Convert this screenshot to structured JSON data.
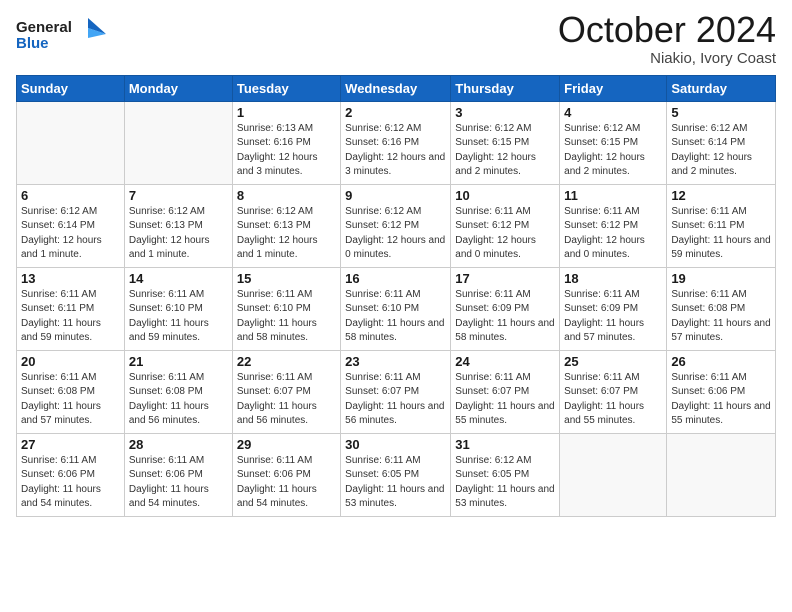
{
  "header": {
    "logo_line1": "General",
    "logo_line2": "Blue",
    "month": "October 2024",
    "location": "Niakio, Ivory Coast"
  },
  "weekdays": [
    "Sunday",
    "Monday",
    "Tuesday",
    "Wednesday",
    "Thursday",
    "Friday",
    "Saturday"
  ],
  "weeks": [
    [
      {
        "day": "",
        "info": ""
      },
      {
        "day": "",
        "info": ""
      },
      {
        "day": "1",
        "info": "Sunrise: 6:13 AM\nSunset: 6:16 PM\nDaylight: 12 hours and 3 minutes."
      },
      {
        "day": "2",
        "info": "Sunrise: 6:12 AM\nSunset: 6:16 PM\nDaylight: 12 hours and 3 minutes."
      },
      {
        "day": "3",
        "info": "Sunrise: 6:12 AM\nSunset: 6:15 PM\nDaylight: 12 hours and 2 minutes."
      },
      {
        "day": "4",
        "info": "Sunrise: 6:12 AM\nSunset: 6:15 PM\nDaylight: 12 hours and 2 minutes."
      },
      {
        "day": "5",
        "info": "Sunrise: 6:12 AM\nSunset: 6:14 PM\nDaylight: 12 hours and 2 minutes."
      }
    ],
    [
      {
        "day": "6",
        "info": "Sunrise: 6:12 AM\nSunset: 6:14 PM\nDaylight: 12 hours and 1 minute."
      },
      {
        "day": "7",
        "info": "Sunrise: 6:12 AM\nSunset: 6:13 PM\nDaylight: 12 hours and 1 minute."
      },
      {
        "day": "8",
        "info": "Sunrise: 6:12 AM\nSunset: 6:13 PM\nDaylight: 12 hours and 1 minute."
      },
      {
        "day": "9",
        "info": "Sunrise: 6:12 AM\nSunset: 6:12 PM\nDaylight: 12 hours and 0 minutes."
      },
      {
        "day": "10",
        "info": "Sunrise: 6:11 AM\nSunset: 6:12 PM\nDaylight: 12 hours and 0 minutes."
      },
      {
        "day": "11",
        "info": "Sunrise: 6:11 AM\nSunset: 6:12 PM\nDaylight: 12 hours and 0 minutes."
      },
      {
        "day": "12",
        "info": "Sunrise: 6:11 AM\nSunset: 6:11 PM\nDaylight: 11 hours and 59 minutes."
      }
    ],
    [
      {
        "day": "13",
        "info": "Sunrise: 6:11 AM\nSunset: 6:11 PM\nDaylight: 11 hours and 59 minutes."
      },
      {
        "day": "14",
        "info": "Sunrise: 6:11 AM\nSunset: 6:10 PM\nDaylight: 11 hours and 59 minutes."
      },
      {
        "day": "15",
        "info": "Sunrise: 6:11 AM\nSunset: 6:10 PM\nDaylight: 11 hours and 58 minutes."
      },
      {
        "day": "16",
        "info": "Sunrise: 6:11 AM\nSunset: 6:10 PM\nDaylight: 11 hours and 58 minutes."
      },
      {
        "day": "17",
        "info": "Sunrise: 6:11 AM\nSunset: 6:09 PM\nDaylight: 11 hours and 58 minutes."
      },
      {
        "day": "18",
        "info": "Sunrise: 6:11 AM\nSunset: 6:09 PM\nDaylight: 11 hours and 57 minutes."
      },
      {
        "day": "19",
        "info": "Sunrise: 6:11 AM\nSunset: 6:08 PM\nDaylight: 11 hours and 57 minutes."
      }
    ],
    [
      {
        "day": "20",
        "info": "Sunrise: 6:11 AM\nSunset: 6:08 PM\nDaylight: 11 hours and 57 minutes."
      },
      {
        "day": "21",
        "info": "Sunrise: 6:11 AM\nSunset: 6:08 PM\nDaylight: 11 hours and 56 minutes."
      },
      {
        "day": "22",
        "info": "Sunrise: 6:11 AM\nSunset: 6:07 PM\nDaylight: 11 hours and 56 minutes."
      },
      {
        "day": "23",
        "info": "Sunrise: 6:11 AM\nSunset: 6:07 PM\nDaylight: 11 hours and 56 minutes."
      },
      {
        "day": "24",
        "info": "Sunrise: 6:11 AM\nSunset: 6:07 PM\nDaylight: 11 hours and 55 minutes."
      },
      {
        "day": "25",
        "info": "Sunrise: 6:11 AM\nSunset: 6:07 PM\nDaylight: 11 hours and 55 minutes."
      },
      {
        "day": "26",
        "info": "Sunrise: 6:11 AM\nSunset: 6:06 PM\nDaylight: 11 hours and 55 minutes."
      }
    ],
    [
      {
        "day": "27",
        "info": "Sunrise: 6:11 AM\nSunset: 6:06 PM\nDaylight: 11 hours and 54 minutes."
      },
      {
        "day": "28",
        "info": "Sunrise: 6:11 AM\nSunset: 6:06 PM\nDaylight: 11 hours and 54 minutes."
      },
      {
        "day": "29",
        "info": "Sunrise: 6:11 AM\nSunset: 6:06 PM\nDaylight: 11 hours and 54 minutes."
      },
      {
        "day": "30",
        "info": "Sunrise: 6:11 AM\nSunset: 6:05 PM\nDaylight: 11 hours and 53 minutes."
      },
      {
        "day": "31",
        "info": "Sunrise: 6:12 AM\nSunset: 6:05 PM\nDaylight: 11 hours and 53 minutes."
      },
      {
        "day": "",
        "info": ""
      },
      {
        "day": "",
        "info": ""
      }
    ]
  ]
}
